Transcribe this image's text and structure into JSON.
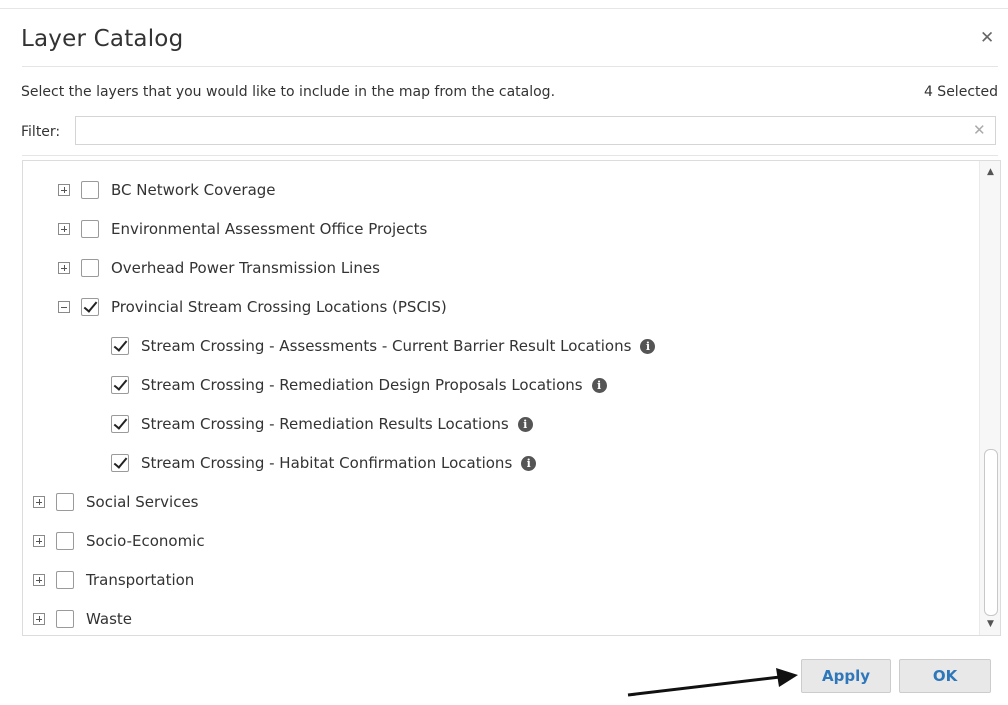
{
  "dialog": {
    "title": "Layer Catalog",
    "close_icon": "close-icon",
    "instructions": "Select the layers that you would like to include in the map from the catalog.",
    "selected_count": "4 Selected"
  },
  "filter": {
    "label": "Filter:",
    "value": "",
    "placeholder": "",
    "clear_icon": "clear-icon"
  },
  "tree": {
    "rows": [
      {
        "label": "BC Network Coverage",
        "level": 1,
        "expander": "plus",
        "checked": false,
        "info": false
      },
      {
        "label": "Environmental Assessment Office Projects",
        "level": 1,
        "expander": "plus",
        "checked": false,
        "info": false
      },
      {
        "label": "Overhead Power Transmission Lines",
        "level": 1,
        "expander": "plus",
        "checked": false,
        "info": false
      },
      {
        "label": "Provincial Stream Crossing Locations (PSCIS)",
        "level": 1,
        "expander": "minus",
        "checked": true,
        "info": false
      },
      {
        "label": "Stream Crossing - Assessments - Current Barrier Result Locations",
        "level": 2,
        "expander": "none",
        "checked": true,
        "info": true
      },
      {
        "label": "Stream Crossing - Remediation Design Proposals Locations",
        "level": 2,
        "expander": "none",
        "checked": true,
        "info": true
      },
      {
        "label": "Stream Crossing - Remediation Results Locations",
        "level": 2,
        "expander": "none",
        "checked": true,
        "info": true
      },
      {
        "label": "Stream Crossing - Habitat Confirmation Locations",
        "level": 2,
        "expander": "none",
        "checked": true,
        "info": true
      },
      {
        "label": "Social Services",
        "level": 0,
        "expander": "plus",
        "checked": false,
        "info": false
      },
      {
        "label": "Socio-Economic",
        "level": 0,
        "expander": "plus",
        "checked": false,
        "info": false
      },
      {
        "label": "Transportation",
        "level": 0,
        "expander": "plus",
        "checked": false,
        "info": false
      },
      {
        "label": "Waste",
        "level": 0,
        "expander": "plus",
        "checked": false,
        "info": false
      }
    ]
  },
  "scrollbar": {
    "up_icon": "scroll-up-arrow-icon",
    "down_icon": "scroll-down-arrow-icon"
  },
  "footer": {
    "apply_label": "Apply",
    "ok_label": "OK"
  },
  "colors": {
    "button_text": "#2e77bb",
    "button_bg": "#e8e8e8",
    "arrow": "#111111"
  }
}
